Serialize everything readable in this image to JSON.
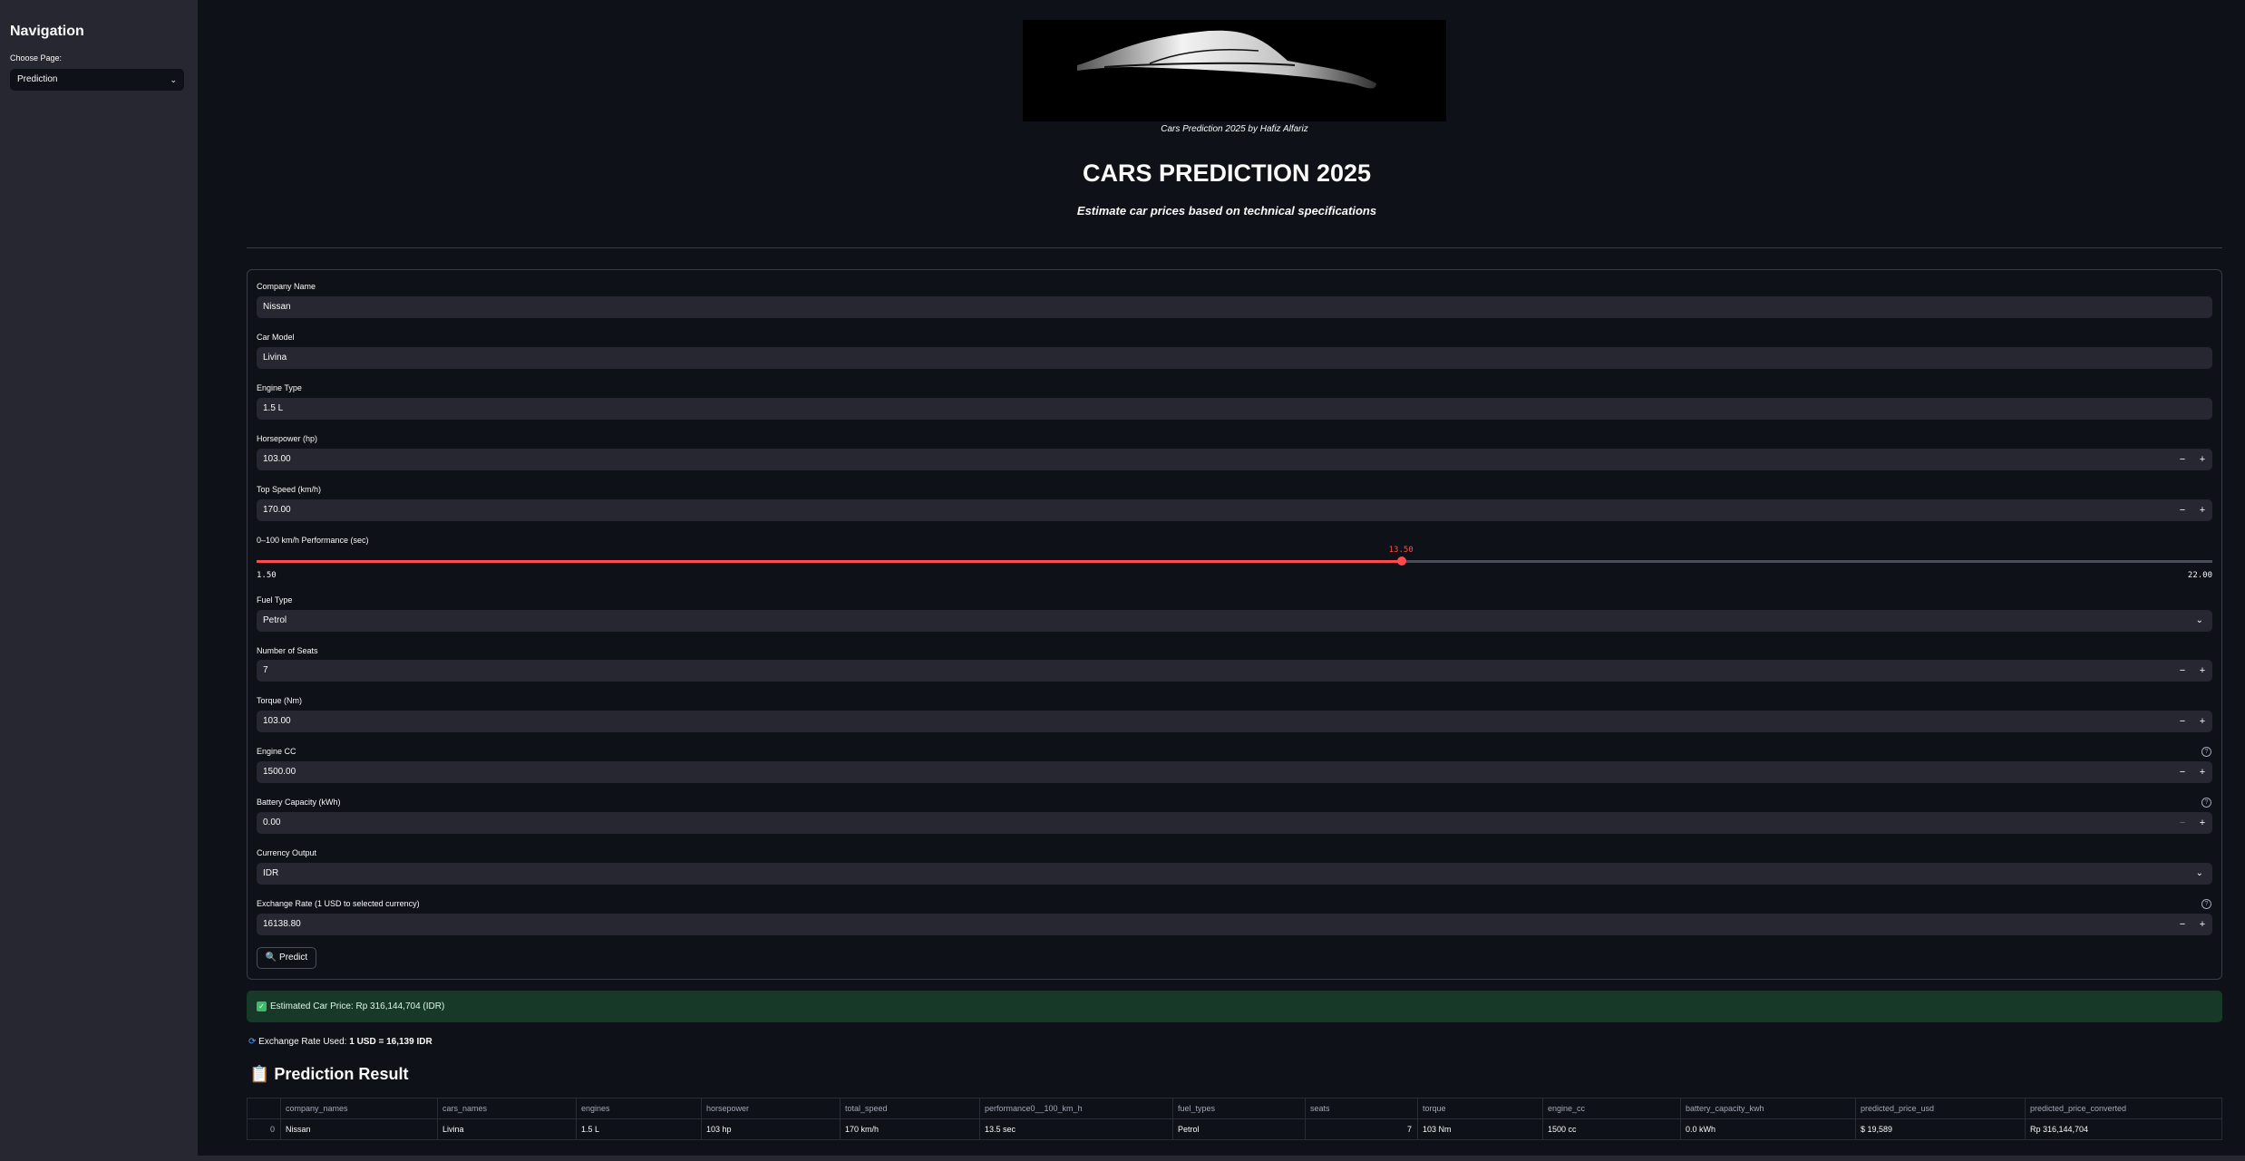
{
  "sidebar": {
    "title": "Navigation",
    "choose_label": "Choose Page:",
    "selected_page": "Prediction"
  },
  "header": {
    "caption": "Cars Prediction 2025 by Hafiz Alfariz",
    "title": "CARS PREDICTION 2025",
    "subtitle": "Estimate car prices based on technical specifications"
  },
  "form": {
    "company_label": "Company Name",
    "company_value": "Nissan",
    "model_label": "Car Model",
    "model_value": "Livina",
    "engine_label": "Engine Type",
    "engine_value": "1.5 L",
    "hp_label": "Horsepower (hp)",
    "hp_value": "103.00",
    "speed_label": "Top Speed (km/h)",
    "speed_value": "170.00",
    "perf_label": "0–100 km/h Performance (sec)",
    "perf_value": "13.50",
    "perf_value_num": 13.5,
    "perf_min": "1.50",
    "perf_min_num": 1.5,
    "perf_max": "22.00",
    "perf_max_num": 22.0,
    "fuel_label": "Fuel Type",
    "fuel_value": "Petrol",
    "seats_label": "Number of Seats",
    "seats_value": "7",
    "torque_label": "Torque (Nm)",
    "torque_value": "103.00",
    "cc_label": "Engine CC",
    "cc_value": "1500.00",
    "battery_label": "Battery Capacity (kWh)",
    "battery_value": "0.00",
    "currency_label": "Currency Output",
    "currency_value": "IDR",
    "exrate_label": "Exchange Rate (1 USD to selected currency)",
    "exrate_value": "16138.80",
    "predict_label": "🔍 Predict",
    "minus": "−",
    "plus": "+",
    "help": "?"
  },
  "result": {
    "success_text": "Estimated Car Price: Rp 316,144,704 (IDR)",
    "rate_prefix": "Exchange Rate Used: ",
    "rate_value": "1 USD = 16,139 IDR",
    "heading": "📋 Prediction Result"
  },
  "table": {
    "columns": [
      "",
      "company_names",
      "cars_names",
      "engines",
      "horsepower",
      "total_speed",
      "performance0__100_km_h",
      "fuel_types",
      "seats",
      "torque",
      "engine_cc",
      "battery_capacity_kwh",
      "predicted_price_usd",
      "predicted_price_converted"
    ],
    "rows": [
      [
        "0",
        "Nissan",
        "Livina",
        "1.5 L",
        "103 hp",
        "170 km/h",
        "13.5 sec",
        "Petrol",
        "7",
        "103 Nm",
        "1500 cc",
        "0.0 kWh",
        "$ 19,589",
        "Rp 316,144,704"
      ]
    ]
  },
  "colors": {
    "accent": "#ff4b4b",
    "background": "#0e1117",
    "sidebar": "#262730",
    "success": "#173928"
  }
}
